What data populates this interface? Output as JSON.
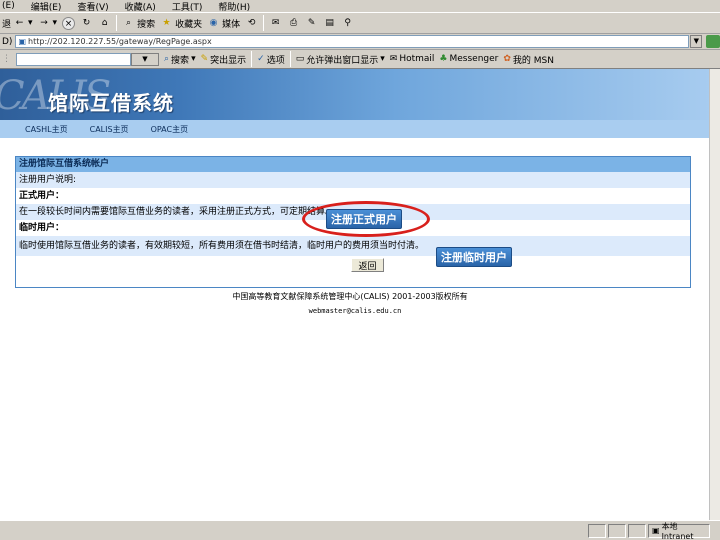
{
  "menubar": {
    "items": [
      "(E)",
      "编辑(E)",
      "查看(V)",
      "收藏(A)",
      "工具(T)",
      "帮助(H)"
    ]
  },
  "toolbar": {
    "back_label": "退",
    "search_label": "搜索",
    "favorites_label": "收藏夹",
    "media_label": "媒体"
  },
  "address": {
    "label": "D)",
    "url": "http://202.120.227.55/gateway/RegPage.aspx"
  },
  "links_toolbar": {
    "search_label": "搜索",
    "highlight_label": "突出显示",
    "options_label": "选项",
    "popups_label": "允许弹出窗口显示",
    "hotmail_label": "Hotmail",
    "messenger_label": "Messenger",
    "msn_label": "我的 MSN"
  },
  "banner": {
    "logo_text": "CALIS",
    "title": "馆际互借系统"
  },
  "nav": {
    "links": [
      "CASHL主页",
      "CALIS主页",
      "OPAC主页"
    ]
  },
  "register": {
    "title": "注册馆际互借系统帐户",
    "desc_label": "注册用户说明:",
    "formal_label": "正式用户：",
    "formal_desc": "在一段较长时间内需要馆际互借业务的读者，采用注册正式方式，可定期结算。",
    "temp_label": "临时用户：",
    "temp_desc": "临时使用馆际互借业务的读者，有效期较短，所有费用须在借书时结清，临时用户的费用须当时付清。",
    "back_button": "返回"
  },
  "callouts": {
    "formal": "注册正式用户",
    "temp": "注册临时用户"
  },
  "footer": {
    "copyright": "中国高等教育文献保障系统管理中心(CALIS) 2001-2003版权所有",
    "email": "webmaster@calis.edu.cn"
  },
  "status": {
    "zone": "本地 Intranet"
  }
}
